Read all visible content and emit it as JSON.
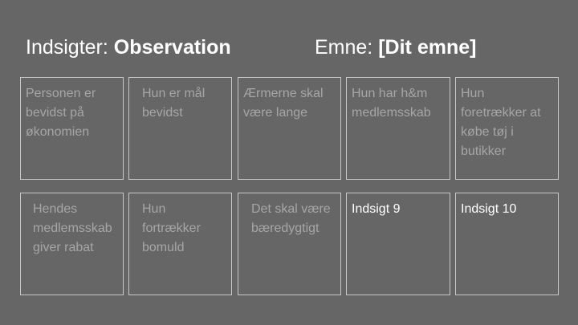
{
  "header": {
    "left_label": "Indsigter:",
    "left_value": "Observation",
    "right_label": "Emne:",
    "right_value": "[Dit emne]"
  },
  "cards": [
    {
      "text": "Personen er bevidst på økonomien"
    },
    {
      "text": "Hun er mål bevidst"
    },
    {
      "text": "Ærmerne skal være lange"
    },
    {
      "text": "Hun har h&m medlemsskab"
    },
    {
      "text": "Hun foretrækker at købe tøj i butikker"
    },
    {
      "text": "Hendes medlemsskab giver rabat"
    },
    {
      "text": "Hun fortrækker bomuld"
    },
    {
      "text": "Det skal være bæredygtigt"
    },
    {
      "text": "Indsigt 9"
    },
    {
      "text": "Indsigt 10"
    }
  ]
}
